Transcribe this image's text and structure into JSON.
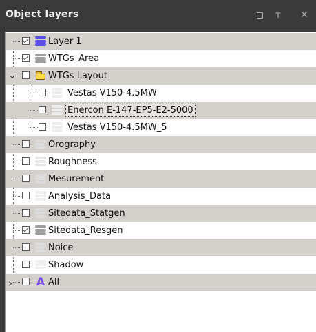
{
  "panel": {
    "title": "Object layers",
    "restore_label": "□",
    "pin_label": "₸",
    "close_label": "✕"
  },
  "layers": [
    {
      "label": "Layer 1",
      "checked": true,
      "icon": "layers-blue-icon",
      "icon_color": "#5a4ee6"
    },
    {
      "label": "WTGs_Area",
      "checked": true,
      "icon": "layers-gray-icon",
      "icon_color": "#9e9e9e"
    },
    {
      "label": "WTGs Layout",
      "checked": false,
      "icon": "folder-open-icon",
      "expanded": true
    },
    {
      "label": "Vestas V150-4.5MW",
      "checked": false,
      "icon": "layers-white-icon",
      "icon_color": "#ededed"
    },
    {
      "label": "Enercon E-147-EP5-E2-5000",
      "checked": false,
      "icon": "layers-white-icon",
      "icon_color": "#ededed",
      "selected": true
    },
    {
      "label": "Vestas V150-4.5MW_5",
      "checked": false,
      "icon": "layers-white-icon",
      "icon_color": "#ededed"
    },
    {
      "label": "Orography",
      "checked": false,
      "icon": "layers-light-icon",
      "icon_color": "#dcdcdc"
    },
    {
      "label": "Roughness",
      "checked": false,
      "icon": "layers-light-icon",
      "icon_color": "#e8e8e8"
    },
    {
      "label": "Mesurement",
      "checked": false,
      "icon": "layers-light-icon",
      "icon_color": "#dcdcdc"
    },
    {
      "label": "Analysis_Data",
      "checked": false,
      "icon": "layers-white-icon",
      "icon_color": "#f0f0f0"
    },
    {
      "label": "Sitedata_Statgen",
      "checked": false,
      "icon": "layers-light-icon",
      "icon_color": "#dcdcdc"
    },
    {
      "label": "Sitedata_Resgen",
      "checked": true,
      "icon": "layers-gray-icon",
      "icon_color": "#9e9e9e"
    },
    {
      "label": "Noice",
      "checked": false,
      "icon": "layers-light-icon",
      "icon_color": "#dcdcdc"
    },
    {
      "label": "Shadow",
      "checked": false,
      "icon": "layers-white-icon",
      "icon_color": "#f0f0f0"
    },
    {
      "label": "All",
      "checked": false,
      "icon": "all-layers-icon",
      "icon_color": "#7b4cf0",
      "collapsed": true
    }
  ]
}
